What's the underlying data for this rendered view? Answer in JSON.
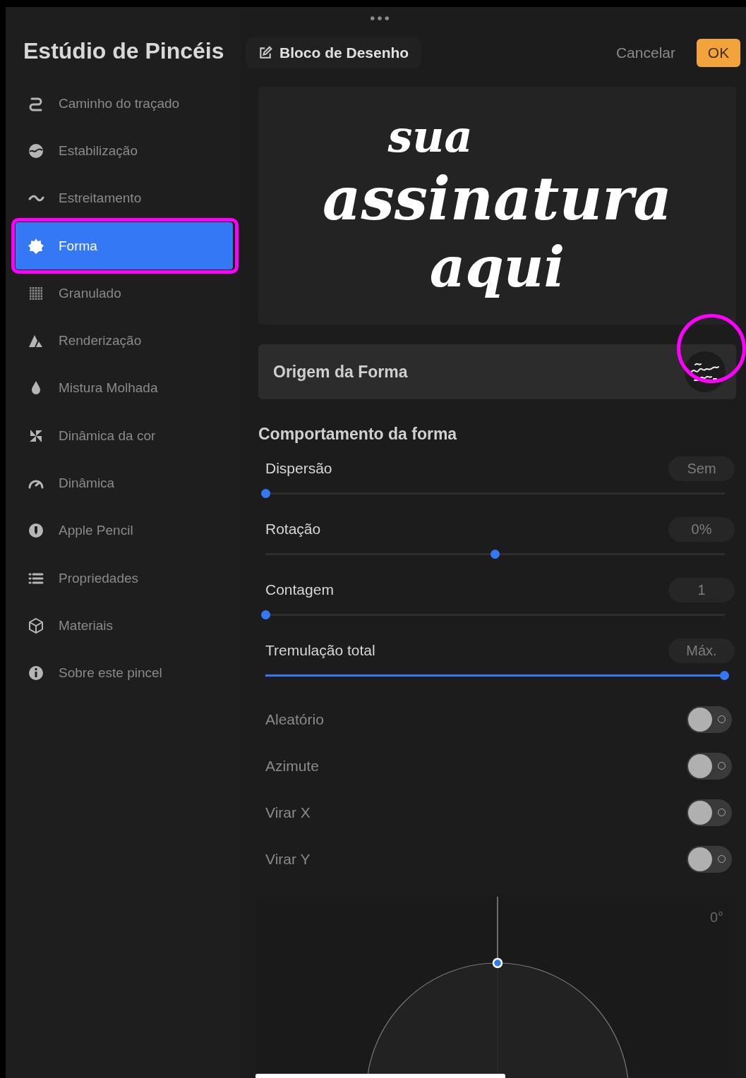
{
  "sidebar": {
    "title": "Estúdio de Pincéis",
    "items": [
      {
        "label": "Caminho do traçado",
        "selected": false,
        "highlighted": false
      },
      {
        "label": "Estabilização",
        "selected": false,
        "highlighted": false
      },
      {
        "label": "Estreitamento",
        "selected": false,
        "highlighted": false
      },
      {
        "label": "Forma",
        "selected": true,
        "highlighted": true
      },
      {
        "label": "Granulado",
        "selected": false,
        "highlighted": false
      },
      {
        "label": "Renderização",
        "selected": false,
        "highlighted": false
      },
      {
        "label": "Mistura Molhada",
        "selected": false,
        "highlighted": false
      },
      {
        "label": "Dinâmica da cor",
        "selected": false,
        "highlighted": false
      },
      {
        "label": "Dinâmica",
        "selected": false,
        "highlighted": false
      },
      {
        "label": "Apple Pencil",
        "selected": false,
        "highlighted": false
      },
      {
        "label": "Propriedades",
        "selected": false,
        "highlighted": false
      },
      {
        "label": "Materiais",
        "selected": false,
        "highlighted": false
      },
      {
        "label": "Sobre este pincel",
        "selected": false,
        "highlighted": false
      }
    ]
  },
  "header": {
    "pad_button": "Bloco de Desenho",
    "cancel": "Cancelar",
    "ok": "OK"
  },
  "preview": {
    "lines": [
      "sua",
      "assinatura",
      "aqui"
    ]
  },
  "shape_source": {
    "label": "Origem da Forma",
    "highlighted": true
  },
  "section_title": "Comportamento da forma",
  "sliders": [
    {
      "label": "Dispersão",
      "value": "Sem",
      "level": 0,
      "filled": false
    },
    {
      "label": "Rotação",
      "value": "0%",
      "level": 0.5,
      "filled": false
    },
    {
      "label": "Contagem",
      "value": "1",
      "level": 0,
      "filled": false
    },
    {
      "label": "Tremulação total",
      "value": "Máx.",
      "level": 1,
      "filled": true
    }
  ],
  "toggles": [
    {
      "label": "Aleatório",
      "on": false
    },
    {
      "label": "Azimute",
      "on": false
    },
    {
      "label": "Virar X",
      "on": false
    },
    {
      "label": "Virar Y",
      "on": false
    }
  ],
  "angle": {
    "reading": "0°"
  }
}
